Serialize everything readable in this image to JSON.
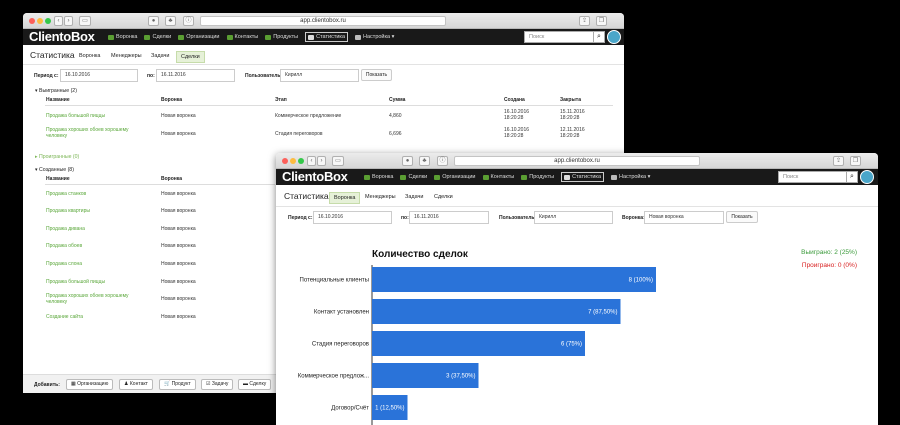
{
  "browser": {
    "url": "app.clientobox.ru"
  },
  "app": {
    "logo": "ClientoBox",
    "nav": [
      "Воронка",
      "Сделки",
      "Организации",
      "Контакты",
      "Продукты",
      "Статистика",
      "Настройка"
    ],
    "search_placeholder": "Поиск",
    "page_title": "Статистика"
  },
  "back": {
    "tabs": [
      "Воронка",
      "Менеджеры",
      "Задачи",
      "Сделки"
    ],
    "filter": {
      "period_from_label": "Период с:",
      "from_value": "16.10.2016",
      "to_label": "по:",
      "to_value": "16.11.2016",
      "user_label": "Пользователь:",
      "user_value": "Кирилл",
      "show_label": "Показать"
    },
    "won": {
      "title": "Выигранные (2)",
      "headers": [
        "Название",
        "Воронка",
        "Этап",
        "Сумма",
        "Создана",
        "Закрыта"
      ],
      "rows": [
        {
          "name": "Продажа большой пиццы",
          "funnel": "Новая воронка",
          "stage": "Коммерческое предложение",
          "sum": "4,860",
          "created": "16.10.2016 18:20:28",
          "closed": "15.11.2016 18:20:28"
        },
        {
          "name": "Продажа хороших обоев хорошему человеку",
          "funnel": "Новая воронка",
          "stage": "Стадия переговоров",
          "sum": "6,696",
          "created": "16.10.2016 18:20:28",
          "closed": "12.11.2016 18:20:28"
        }
      ]
    },
    "lost_title": "Проигранные (0)",
    "created": {
      "title": "Созданные (8)",
      "headers": [
        "Название",
        "Воронка"
      ],
      "rows": [
        {
          "name": "Продажа станков",
          "funnel": "Новая воронка"
        },
        {
          "name": "Продажа квартиры",
          "funnel": "Новая воронка"
        },
        {
          "name": "Продажа дивана",
          "funnel": "Новая воронка"
        },
        {
          "name": "Продажа обоев",
          "funnel": "Новая воронка"
        },
        {
          "name": "Продажа слона",
          "funnel": "Новая воронка"
        },
        {
          "name": "Продажа большой пиццы",
          "funnel": "Новая воронка"
        },
        {
          "name": "Продажа хороших обоев хорошему человеку",
          "funnel": "Новая воронка"
        },
        {
          "name": "Создание сайта",
          "funnel": "Новая воронка"
        }
      ]
    },
    "footer": {
      "add_label": "Добавить:",
      "buttons": [
        "Организацию",
        "Контакт",
        "Продукт",
        "Задачу",
        "Сделку"
      ]
    }
  },
  "front": {
    "tabs": [
      "Воронка",
      "Менеджеры",
      "Задачи",
      "Сделки"
    ],
    "filter": {
      "period_from_label": "Период с:",
      "from_value": "16.10.2016",
      "to_label": "по:",
      "to_value": "16.11.2016",
      "user_label": "Пользователь:",
      "user_value": "Кирилл",
      "funnel_label": "Воронка:",
      "funnel_value": "Новая воронка",
      "show_label": "Показать"
    },
    "won_summary": "Выиграно: 2 (25%)",
    "lost_summary": "Проиграно: 0 (0%)"
  },
  "colors": {
    "bar": "#2a73d9",
    "won": "#3a9a3a",
    "lost": "#d82020",
    "link": "#5aa73a"
  },
  "chart_data": {
    "type": "bar",
    "orientation": "horizontal",
    "title": "Количество сделок",
    "categories": [
      "Потенциальные клиенты",
      "Контакт установлен",
      "Стадия переговоров",
      "Коммерческое предлож...",
      "Договор/Счёт"
    ],
    "values": [
      8,
      7,
      6,
      3,
      1
    ],
    "labels": [
      "8 (100%)",
      "7 (87,50%)",
      "6 (75%)",
      "3 (37,50%)",
      "1 (12,50%)"
    ],
    "xlim": [
      0,
      8
    ]
  }
}
